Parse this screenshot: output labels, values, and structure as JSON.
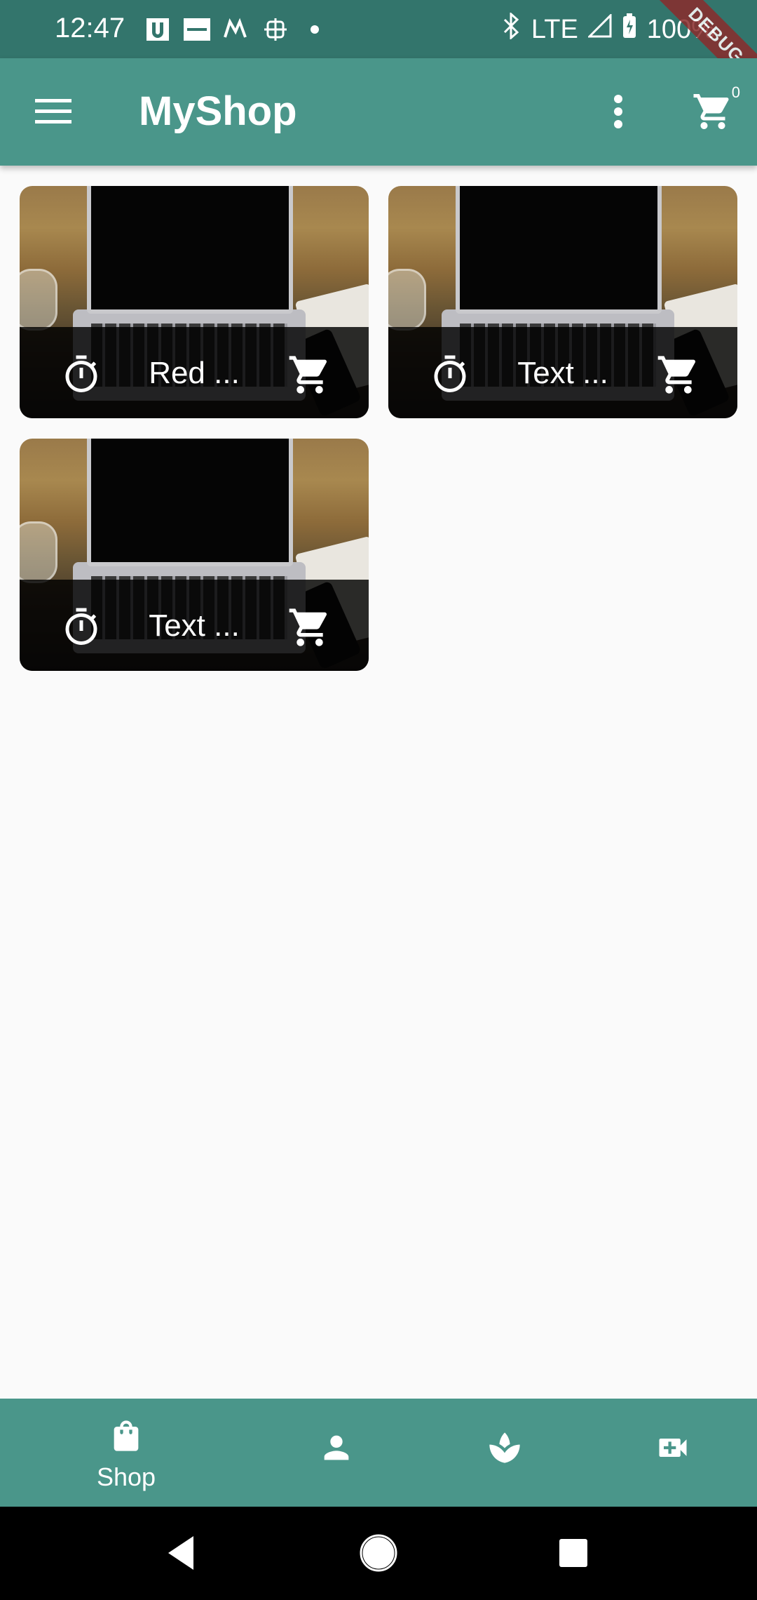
{
  "status_bar": {
    "time": "12:47",
    "network": "LTE",
    "battery": "100%",
    "notification_icons": [
      "uber-icon",
      "zomato-icon",
      "mydukaan-icon",
      "screen-icon",
      "dot-icon"
    ]
  },
  "debug_banner": "DEBUG",
  "app_bar": {
    "title": "MyShop",
    "cart_count": "0"
  },
  "products": [
    {
      "title": "Red ...",
      "image": "laptop-desk-photo"
    },
    {
      "title": "Text ...",
      "image": "laptop-desk-photo"
    },
    {
      "title": "Text ...",
      "image": "laptop-desk-photo"
    }
  ],
  "bottom_nav": {
    "items": [
      {
        "label": "Shop",
        "icon": "shopping-bag-icon",
        "selected": true
      },
      {
        "label": "",
        "icon": "person-icon",
        "selected": false
      },
      {
        "label": "",
        "icon": "spa-leaf-icon",
        "selected": false
      },
      {
        "label": "",
        "icon": "video-call-icon",
        "selected": false
      }
    ]
  },
  "colors": {
    "status_bar": "#33756c",
    "app_bar": "#4a968a",
    "background": "#fafafa",
    "bottom_nav": "#4a968a"
  }
}
